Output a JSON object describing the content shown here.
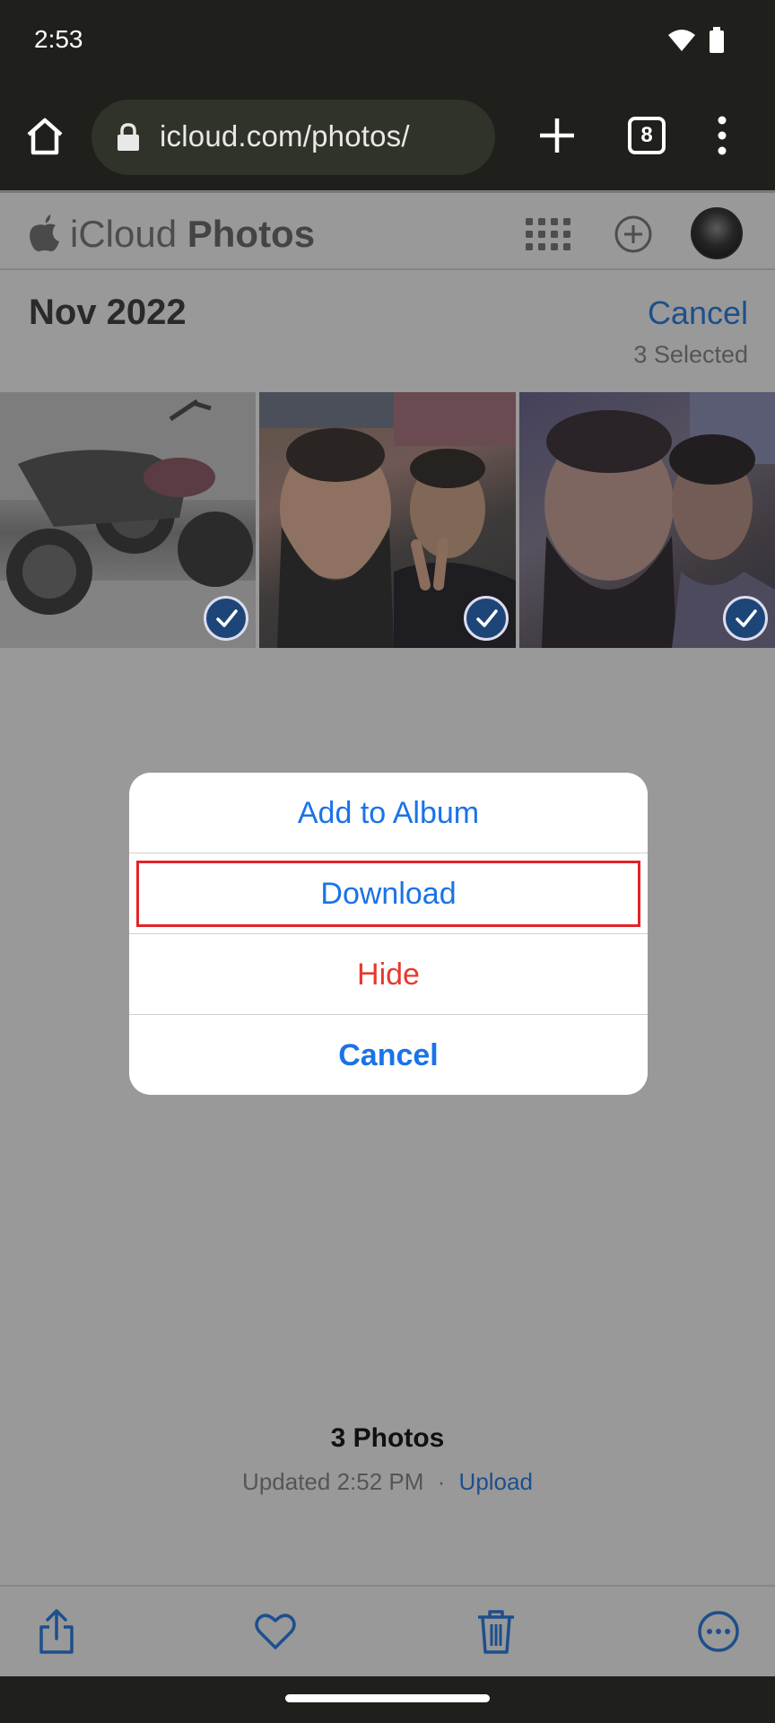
{
  "status_bar": {
    "time": "2:53"
  },
  "browser": {
    "url": "icloud.com/photos/",
    "tab_count": "8"
  },
  "app": {
    "title_prefix": "iCloud",
    "title_main": "Photos"
  },
  "selection": {
    "section_title": "Nov 2022",
    "cancel_label": "Cancel",
    "selected_label": "3 Selected"
  },
  "photos": [
    {
      "description": "motorcycle",
      "selected": true
    },
    {
      "description": "two men selfie",
      "selected": true
    },
    {
      "description": "two men selfie",
      "selected": true
    }
  ],
  "action_sheet": {
    "items": [
      {
        "label": "Add to Album"
      },
      {
        "label": "Download"
      },
      {
        "label": "Hide"
      },
      {
        "label": "Cancel"
      }
    ]
  },
  "footer": {
    "count": "3 Photos",
    "updated": "Updated 2:52 PM",
    "separator": "·",
    "upload_label": "Upload"
  },
  "colors": {
    "accent": "#1a73e8",
    "destructive": "#e8382e",
    "highlight": "#e3232a",
    "overlay": "#999999"
  }
}
